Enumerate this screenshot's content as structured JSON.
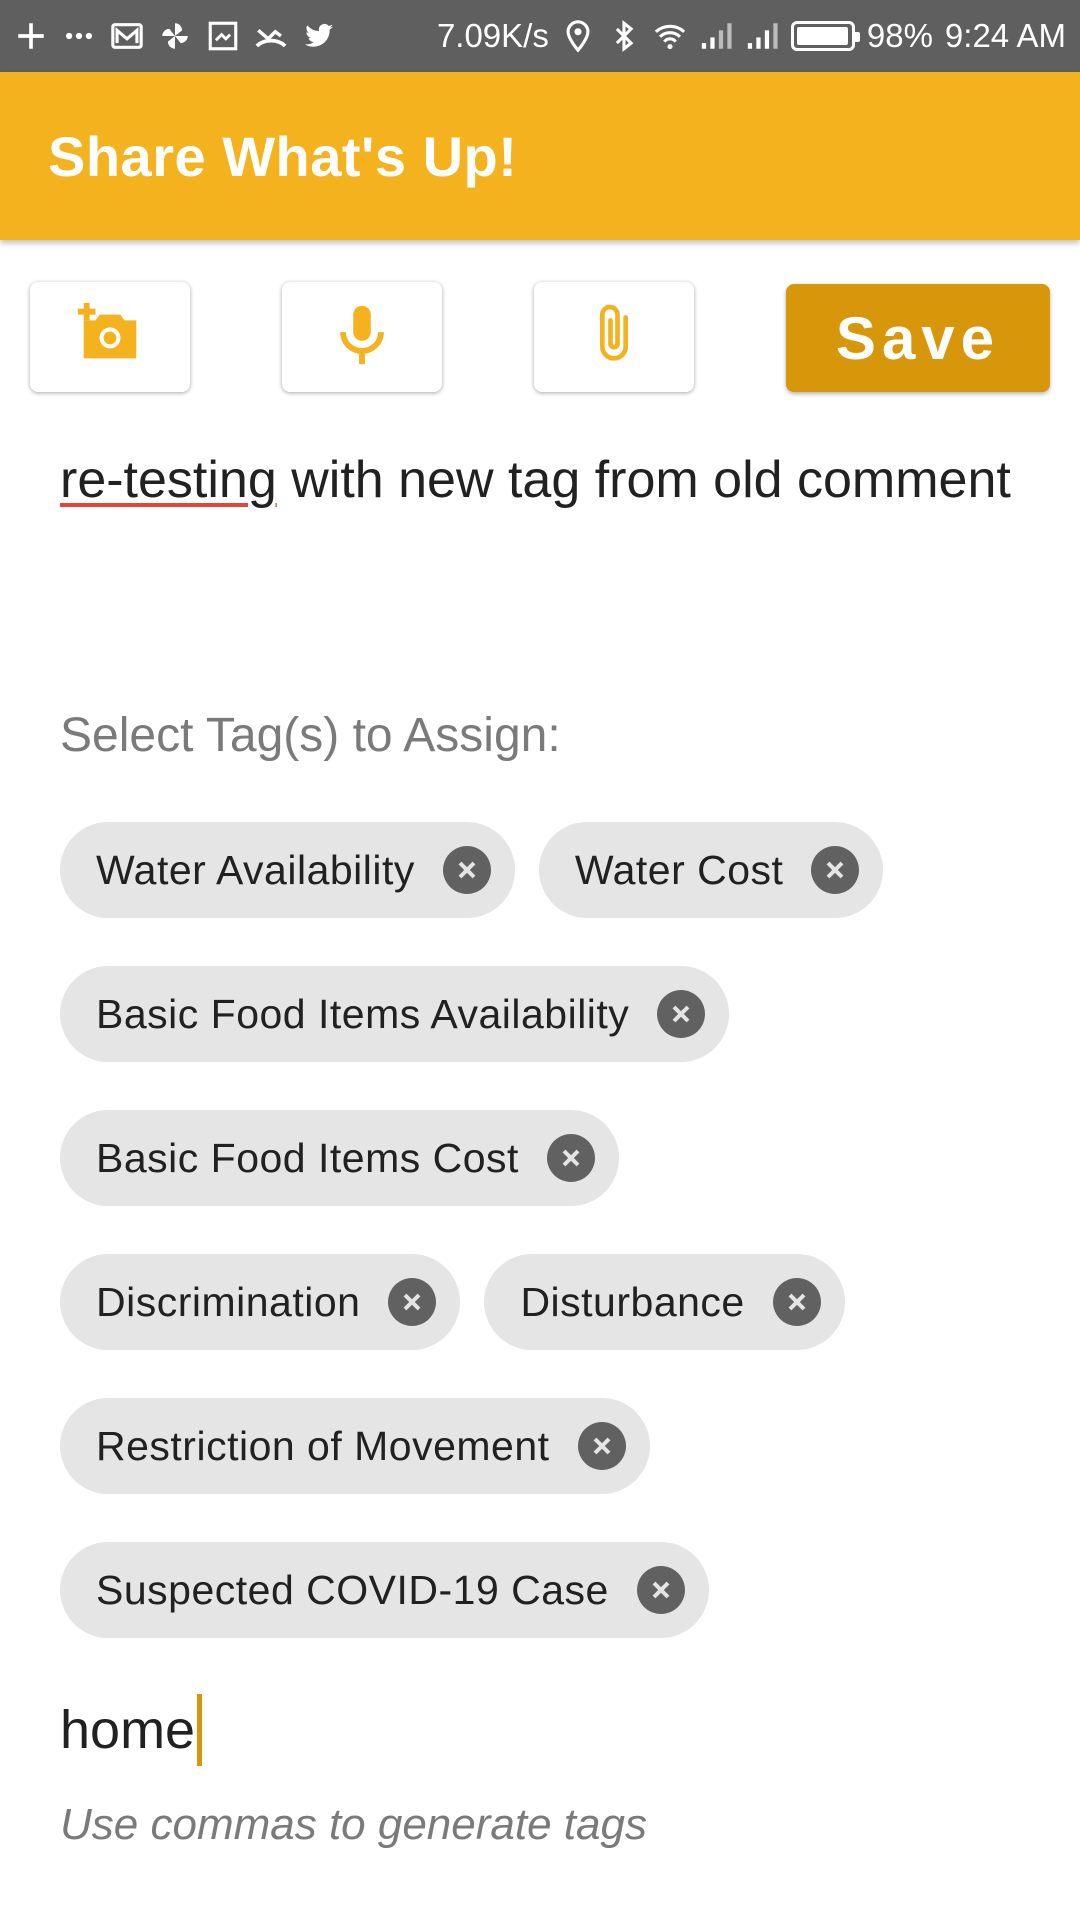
{
  "status_bar": {
    "left_icons": [
      "plus-icon",
      "more-icon",
      "mail-icon",
      "pinwheel-icon",
      "screenshot-icon",
      "missed-call-icon",
      "twitter-icon"
    ],
    "net_speed": "7.09K/s",
    "right_icons": [
      "location-icon",
      "bluetooth-icon",
      "wifi-icon",
      "signal-icon",
      "signal-icon",
      "battery-icon"
    ],
    "battery_level": 0.98,
    "battery": "98%",
    "time": "9:24 AM"
  },
  "app_bar": {
    "title": "Share What's Up!"
  },
  "toolbar": {
    "buttons": [
      "add-photo-icon",
      "microphone-icon",
      "attachment-icon"
    ],
    "save_label": "Save",
    "accent": "#d8960a"
  },
  "comment": {
    "misspelled_word": "re-testing",
    "text_rest": " with new tag from old comment"
  },
  "tags_label": "Select Tag(s) to Assign:",
  "tags": [
    "Water Availability",
    "Water Cost",
    "Basic Food Items Availability",
    "Basic Food Items Cost",
    "Discrimination",
    "Disturbance",
    "Restriction of Movement",
    "Suspected COVID-19 Case"
  ],
  "tag_input": {
    "value": "home",
    "hint": "Use commas to generate tags"
  },
  "colors": {
    "app_bar": "#f4b21e",
    "save_button": "#d8960a",
    "status_bar": "#5f5f5f",
    "chip_bg": "#e5e5e5"
  }
}
